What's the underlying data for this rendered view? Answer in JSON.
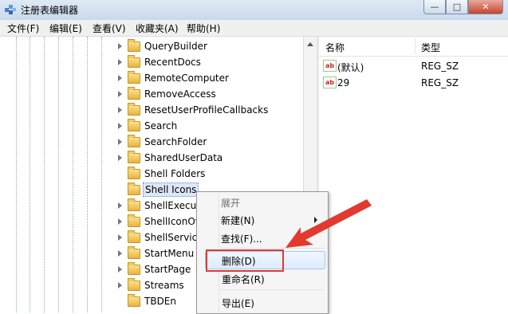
{
  "window": {
    "title": "注册表编辑器",
    "buttons": [
      "—",
      "□",
      "✕"
    ]
  },
  "menubar": [
    "文件(F)",
    "编辑(E)",
    "查看(V)",
    "收藏夹(A)",
    "帮助(H)"
  ],
  "tree": {
    "nodes": [
      {
        "label": "QueryBuilder",
        "expandable": true
      },
      {
        "label": "RecentDocs",
        "expandable": true
      },
      {
        "label": "RemoteComputer",
        "expandable": true
      },
      {
        "label": "RemoveAccess",
        "expandable": true
      },
      {
        "label": "ResetUserProfileCallbacks",
        "expandable": true
      },
      {
        "label": "Search",
        "expandable": true
      },
      {
        "label": "SearchFolder",
        "expandable": true
      },
      {
        "label": "SharedUserData",
        "expandable": true
      },
      {
        "label": "Shell Folders",
        "expandable": false
      },
      {
        "label": "Shell Icons",
        "expandable": false,
        "selected": true
      },
      {
        "label": "ShellExecute",
        "expandable": true
      },
      {
        "label": "ShellIconOverlay",
        "expandable": true
      },
      {
        "label": "ShellServiceObjects",
        "expandable": true
      },
      {
        "label": "StartMenu",
        "expandable": true
      },
      {
        "label": "StartPage",
        "expandable": true
      },
      {
        "label": "Streams",
        "expandable": true
      },
      {
        "label": "TBDEn",
        "expandable": false
      }
    ]
  },
  "list": {
    "headers": {
      "name": "名称",
      "type": "类型"
    },
    "rows": [
      {
        "name": "(默认)",
        "type": "REG_SZ",
        "icon": "ab-string-icon"
      },
      {
        "name": "29",
        "type": "REG_SZ",
        "icon": "ab-string-icon"
      }
    ]
  },
  "context_menu": {
    "items": [
      {
        "label": "展开",
        "disabled": true
      },
      {
        "label": "新建(N)",
        "submenu": true
      },
      {
        "label": "查找(F)..."
      },
      {
        "label": "删除(D)",
        "hovered": true
      },
      {
        "label": "重命名(R)"
      },
      {
        "label": "导出(E)"
      }
    ]
  },
  "annotation": {
    "color": "#e23a2e"
  }
}
